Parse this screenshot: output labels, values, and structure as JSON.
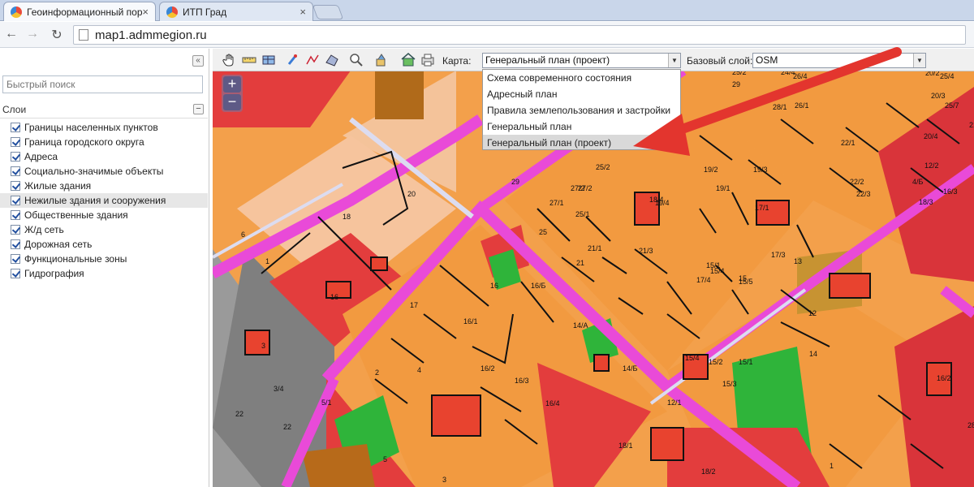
{
  "browser": {
    "tabs": [
      {
        "title": "Геоинформационный пор"
      },
      {
        "title": "ИТП Град"
      }
    ],
    "address": "map1.admmegion.ru"
  },
  "sidebar": {
    "search_placeholder": "Быстрый поиск",
    "layers_title": "Слои",
    "layers": [
      {
        "label": "Границы населенных пунктов",
        "checked": true
      },
      {
        "label": "Граница городского округа",
        "checked": true
      },
      {
        "label": "Адреса",
        "checked": true
      },
      {
        "label": "Социально-значимые объекты",
        "checked": true
      },
      {
        "label": "Жилые здания",
        "checked": true
      },
      {
        "label": "Нежилые здания и сооружения",
        "checked": true
      },
      {
        "label": "Общественные здания",
        "checked": true
      },
      {
        "label": "Ж/д сеть",
        "checked": true
      },
      {
        "label": "Дорожная сеть",
        "checked": true
      },
      {
        "label": "Функциональные зоны",
        "checked": true
      },
      {
        "label": "Гидрография",
        "checked": true
      }
    ]
  },
  "map_toolbar": {
    "map_label": "Карта:",
    "map_selected": "Генеральный план (проект)",
    "base_label": "Базовый слой:",
    "base_selected": "OSM",
    "map_options": [
      "Схема современного состояния",
      "Адресный план",
      "Правила землепользования и застройки",
      "Генеральный план",
      "Генеральный план (проект)"
    ]
  },
  "zoom": {
    "plus": "+",
    "minus": "−"
  },
  "map_labels": [
    "18",
    "20",
    "16",
    "1",
    "6",
    "29",
    "27/2",
    "27/1",
    "25/1",
    "25/2",
    "25",
    "21/1",
    "21",
    "21/3",
    "19/4",
    "19/2",
    "19/1",
    "19/3",
    "17/1",
    "17/3",
    "17/4",
    "15/1",
    "15/4",
    "15/5",
    "15",
    "13",
    "12",
    "14",
    "16",
    "16/Б",
    "17",
    "16/1",
    "16/2",
    "16/3",
    "16/4",
    "14/А",
    "14/Б",
    "15/4",
    "15/2",
    "15/3",
    "15/1",
    "12/1",
    "18/1",
    "18/2",
    "2",
    "4",
    "3",
    "5",
    "22",
    "22",
    "3/4",
    "5/1",
    "27/2",
    "18/4",
    "3",
    "20/2",
    "20/3",
    "20/4",
    "22/1",
    "22/2",
    "22/3",
    "24/4",
    "26/1",
    "26/4",
    "28/1",
    "25/2",
    "25/4",
    "25/7",
    "21",
    "16/2",
    "16/3",
    "18/3",
    "12/2",
    "4/Б",
    "28",
    "29",
    "1"
  ],
  "icons": {
    "tool_pan": "hand-icon",
    "tool_measure": "ruler-icon",
    "tool_area": "area-icon",
    "tool_zoom": "zoom-icon",
    "tool_layers": "layers-icon",
    "tool_print": "print-icon"
  }
}
